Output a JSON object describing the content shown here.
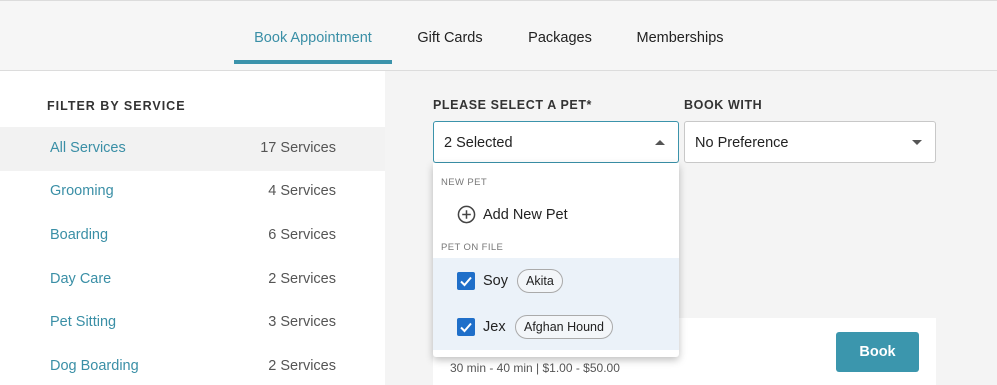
{
  "tabs": [
    {
      "label": "Book Appointment"
    },
    {
      "label": "Gift Cards"
    },
    {
      "label": "Packages"
    },
    {
      "label": "Memberships"
    }
  ],
  "sidebar": {
    "title": "FILTER BY SERVICE",
    "items": [
      {
        "name": "All Services",
        "count": "17 Services"
      },
      {
        "name": "Grooming",
        "count": "4 Services"
      },
      {
        "name": "Boarding",
        "count": "6 Services"
      },
      {
        "name": "Day Care",
        "count": "2 Services"
      },
      {
        "name": "Pet Sitting",
        "count": "3 Services"
      },
      {
        "name": "Dog Boarding",
        "count": "2 Services"
      }
    ]
  },
  "pet_select": {
    "label": "PLEASE SELECT A PET*",
    "value": "2 Selected"
  },
  "book_with": {
    "label": "BOOK WITH",
    "value": "No Preference"
  },
  "dropdown": {
    "new_pet_header": "NEW PET",
    "add_new_label": "Add New Pet",
    "on_file_header": "PET ON FILE",
    "pets": [
      {
        "name": "Soy",
        "breed": "Akita",
        "checked": true
      },
      {
        "name": "Jex",
        "breed": "Afghan Hound",
        "checked": true
      }
    ]
  },
  "service_card": {
    "meta": "30 min - 40 min | $1.00  -  $50.00",
    "book_label": "Book"
  },
  "colors": {
    "accent": "#3b93ab",
    "checkbox": "#1f6fc9"
  }
}
